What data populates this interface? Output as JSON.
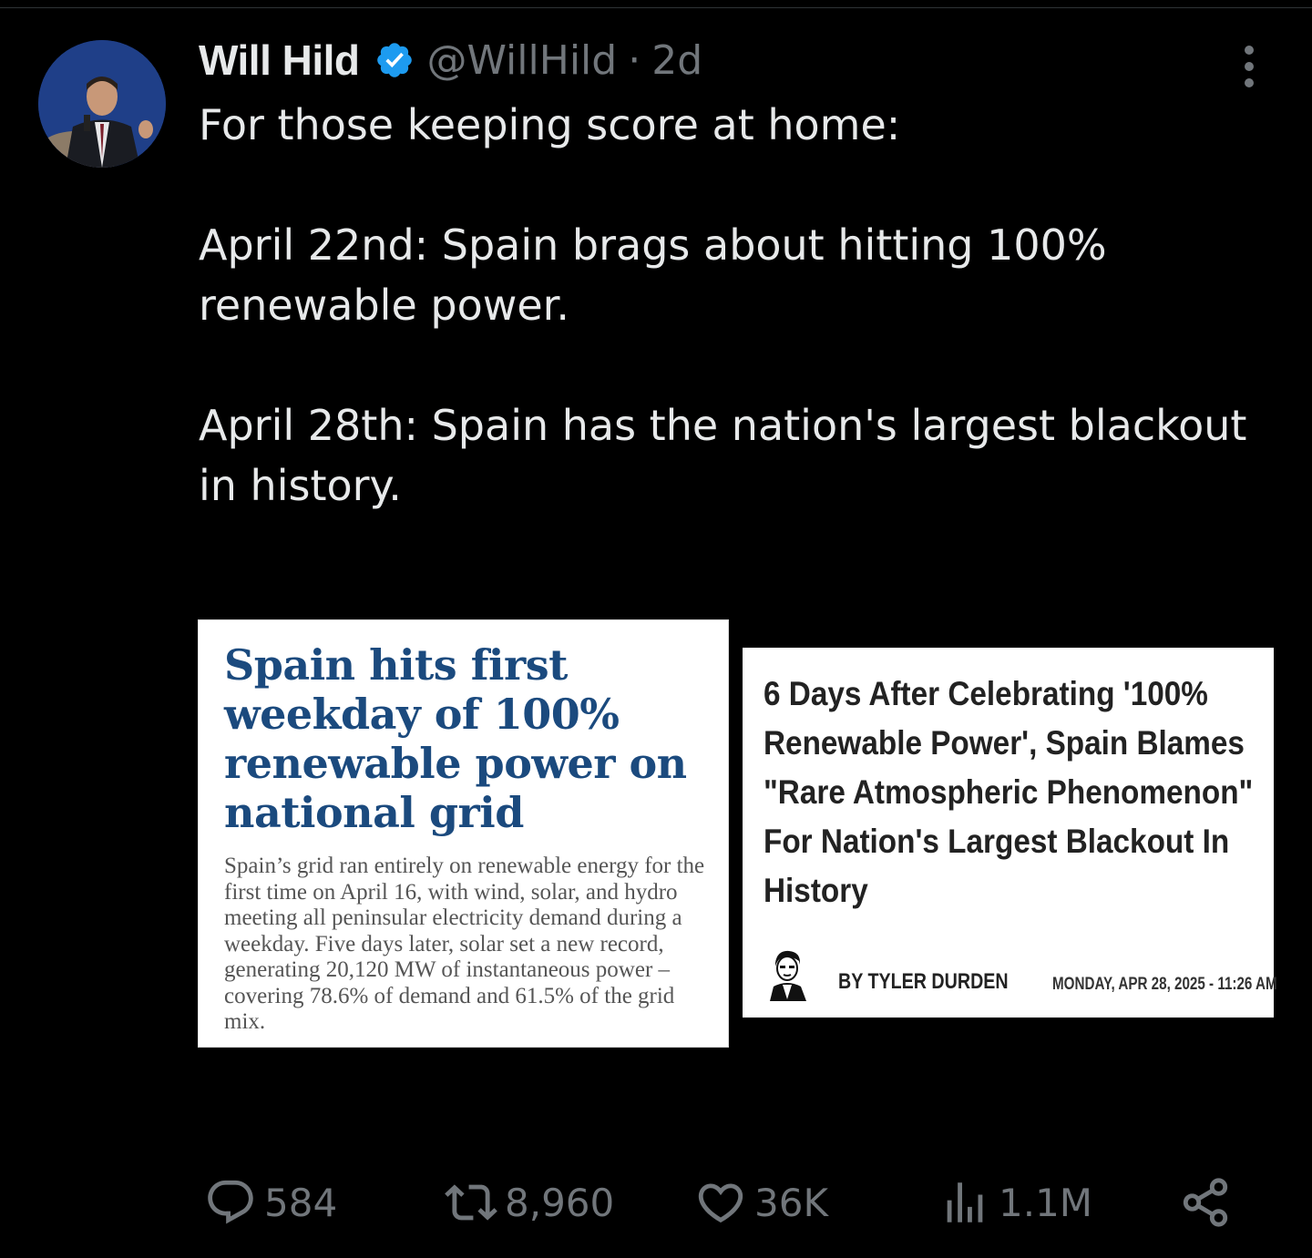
{
  "tweet": {
    "author_name": "Will Hild",
    "handle": "@WillHild",
    "separator": "·",
    "time": "2d",
    "verified_icon": "verified-badge-icon",
    "more_icon": "more-vertical-icon",
    "text_lines": [
      "For those keeping score at home:",
      "April 22nd: Spain brags about hitting 100%",
      "renewable power.",
      "April 28th: Spain has the nation's largest blackout",
      "in history."
    ]
  },
  "media": {
    "left": {
      "headline": "Spain hits first weekday of 100% renewable power on national grid",
      "body": "Spain’s grid ran entirely on renewable energy for the first time on April 16, with wind, solar, and hydro meeting all peninsular electricity demand during a weekday. Five days later, solar set a new record, generating 20,120 MW of instantaneous power – covering 78.6% of demand and 61.5% of the grid mix."
    },
    "right": {
      "headline": "6 Days After Celebrating '100% Renewable Power', Spain Blames \"Rare Atmospheric Phenomenon\" For Nation's Largest Blackout In History",
      "byline": "BY TYLER DURDEN",
      "dateline": "MONDAY, APR 28, 2025 - 11:26 AM"
    }
  },
  "actions": {
    "replies": "584",
    "retweets": "8,960",
    "likes": "36K",
    "views": "1.1M"
  },
  "colors": {
    "background": "#000000",
    "text": "#e7e9ea",
    "muted": "#71767b",
    "verified": "#1d9bf0",
    "left_headline": "#1b4a7e"
  }
}
